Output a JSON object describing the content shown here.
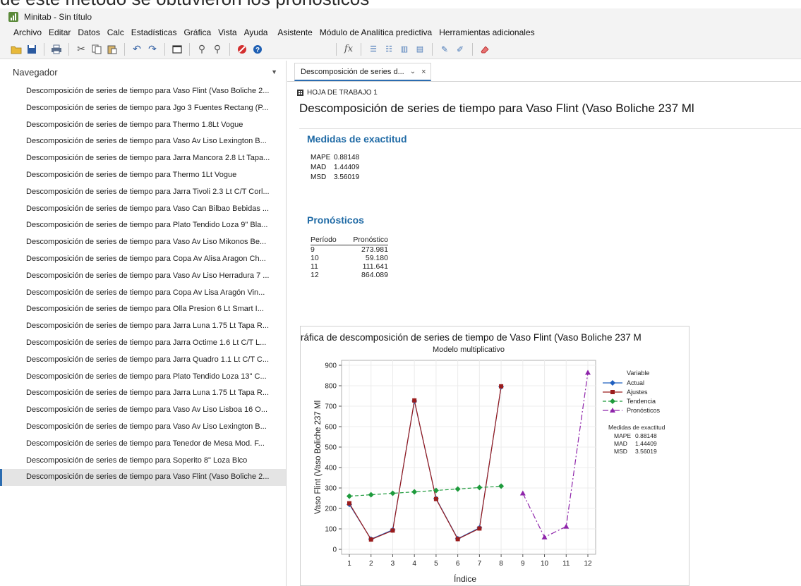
{
  "window": {
    "title": "Minitab - Sin título"
  },
  "top_clipped_text": "de este método se obtuvieron los pronósticos",
  "menu": [
    "Archivo",
    "Editar",
    "Datos",
    "Calc",
    "Estadísticas",
    "Gráfica",
    "Vista",
    "Ayuda",
    "Asistente",
    "Módulo de Analítica predictiva",
    "Herramientas adicionales"
  ],
  "toolbar": {
    "icons": [
      "open-icon",
      "save-icon",
      "print-icon",
      "cut-icon",
      "copy-icon",
      "paste-icon",
      "undo-icon",
      "redo-icon",
      "window-icon",
      "find-icon",
      "find-next-icon",
      "cancel-icon",
      "help-icon",
      "formula-icon",
      "insert-rows-icon",
      "delete-rows-icon",
      "columns-icon",
      "rows-icon",
      "brush-icon",
      "edit-last-icon",
      "eraser-icon"
    ],
    "fx_label": "fx"
  },
  "navigator": {
    "title": "Navegador",
    "items": [
      "Descomposición de series de tiempo para Vaso Flint (Vaso Boliche 2...",
      "Descomposición de series de tiempo para Jgo 3 Fuentes Rectang (P...",
      "Descomposición de series de tiempo para Thermo 1.8Lt Vogue",
      "Descomposición de series de tiempo para Vaso Av Liso Lexington B...",
      "Descomposición de series de tiempo para Jarra Mancora 2.8 Lt Tapa...",
      "Descomposición de series de tiempo para Thermo 1Lt Vogue",
      "Descomposición de series de tiempo para Jarra Tivoli 2.3 Lt C/T Corl...",
      "Descomposición de series de tiempo para Vaso Can Bilbao Bebidas ...",
      "Descomposición de series de tiempo para Plato Tendido Loza 9\" Bla...",
      "Descomposición de series de tiempo para Vaso Av Liso Mikonos Be...",
      "Descomposición de series de tiempo para Copa Av Alisa Aragon Ch...",
      "Descomposición de series de tiempo para Vaso Av Liso Herradura 7 ...",
      "Descomposición de series de tiempo para Copa Av Lisa Aragón Vin...",
      "Descomposición de series de tiempo para Olla Presion 6 Lt Smart I...",
      "Descomposición de series de tiempo para Jarra Luna 1.75 Lt Tapa R...",
      "Descomposición de series de tiempo para Jarra Octime 1.6 Lt C/T L...",
      "Descomposición de series de tiempo para Jarra Quadro 1.1 Lt C/T C...",
      "Descomposición de series de tiempo para Plato Tendido Loza 13\" C...",
      "Descomposición de series de tiempo para Jarra Luna 1.75 Lt Tapa R...",
      "Descomposición de series de tiempo para Vaso Av Liso Lisboa 16 O...",
      "Descomposición de series de tiempo para Vaso Av Liso Lexington B...",
      "Descomposición de series de tiempo para Tenedor de Mesa Mod. F...",
      "Descomposición de series de tiempo para Soperito 8\" Loza Blco",
      "Descomposición de series de tiempo para Vaso Flint (Vaso Boliche 2..."
    ],
    "selected_index": 23
  },
  "tab": {
    "label": "Descomposición de series d...",
    "dropdown": "⌄",
    "close": "×"
  },
  "worksheet_label": "HOJA DE TRABAJO 1",
  "doc_title": "Descomposición de series de tiempo para Vaso Flint (Vaso Boliche 237 Ml",
  "accuracy": {
    "heading": "Medidas de exactitud",
    "rows": [
      {
        "name": "MAPE",
        "value": "0.88148"
      },
      {
        "name": "MAD",
        "value": "1.44409"
      },
      {
        "name": "MSD",
        "value": "3.56019"
      }
    ]
  },
  "forecasts": {
    "heading": "Pronósticos",
    "columns": [
      "Período",
      "Pronóstico"
    ],
    "rows": [
      [
        "9",
        "273.981"
      ],
      [
        "10",
        "59.180"
      ],
      [
        "11",
        "111.641"
      ],
      [
        "12",
        "864.089"
      ]
    ]
  },
  "colors": {
    "accent": "#1f6aa5",
    "actual": "#1f5fbf",
    "fits": "#9b1c1c",
    "trend": "#1e9a3c",
    "forecast": "#8e24aa"
  },
  "chart_data": {
    "type": "line",
    "title": "ráfica de descomposición de series de tiempo de Vaso Flint (Vaso Boliche 237 M",
    "subtitle": "Modelo multiplicativo",
    "xlabel": "Índice",
    "ylabel": "Vaso Flint (Vaso Boliche 237 Ml",
    "xlim": [
      1,
      12
    ],
    "ylim": [
      0,
      900
    ],
    "xticks": [
      1,
      2,
      3,
      4,
      5,
      6,
      7,
      8,
      9,
      10,
      11,
      12
    ],
    "yticks": [
      0,
      100,
      200,
      300,
      400,
      500,
      600,
      700,
      800,
      900
    ],
    "grid": true,
    "legend_title": "Variable",
    "legend_placement": "right",
    "series": [
      {
        "name": "Actual",
        "x": [
          1,
          2,
          3,
          4,
          5,
          6,
          7,
          8
        ],
        "values": [
          220,
          50,
          95,
          725,
          248,
          52,
          105,
          795
        ]
      },
      {
        "name": "Ajustes",
        "x": [
          1,
          2,
          3,
          4,
          5,
          6,
          7,
          8
        ],
        "values": [
          225,
          48,
          92,
          728,
          246,
          50,
          102,
          797
        ]
      },
      {
        "name": "Tendencia",
        "x": [
          1,
          2,
          3,
          4,
          5,
          6,
          7,
          8
        ],
        "values": [
          260,
          267,
          274,
          281,
          288,
          295,
          302,
          309
        ]
      },
      {
        "name": "Pronósticos",
        "x": [
          9,
          10,
          11,
          12
        ],
        "values": [
          273.981,
          59.18,
          111.641,
          864.089
        ]
      }
    ],
    "accuracy_box": {
      "title": "Medidas de exactitud",
      "rows": [
        [
          "MAPE",
          "0.88148"
        ],
        [
          "MAD",
          "1.44409"
        ],
        [
          "MSD",
          "3.56019"
        ]
      ]
    }
  }
}
